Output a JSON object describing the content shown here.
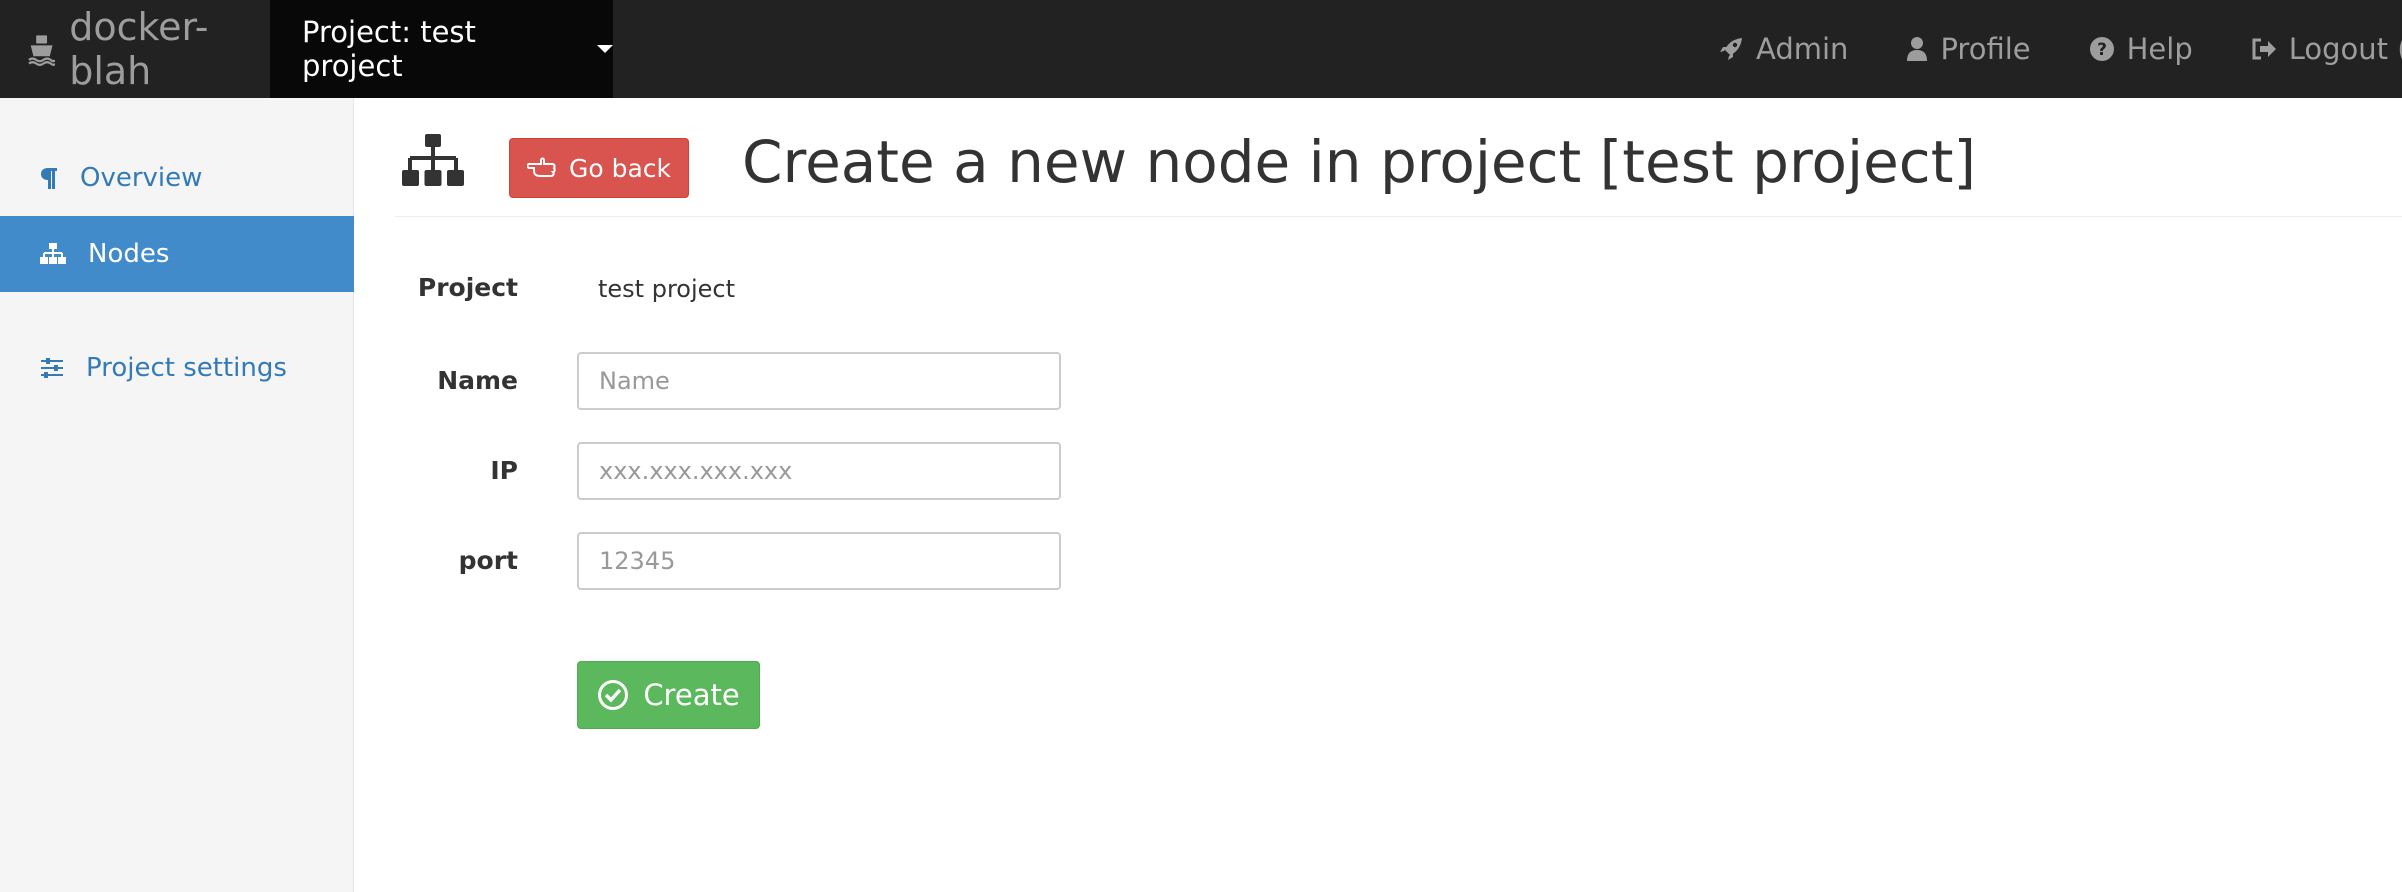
{
  "navbar": {
    "brand": "docker-blah",
    "brand_icon": "ship-icon",
    "project_dropdown": "Project: test project",
    "links": [
      {
        "label": "Admin",
        "icon": "rocket-icon"
      },
      {
        "label": "Profile",
        "icon": "user-icon"
      },
      {
        "label": "Help",
        "icon": "question-circle-icon"
      },
      {
        "label": "Logout (c",
        "icon": "sign-out-icon"
      }
    ]
  },
  "sidebar": {
    "items": [
      {
        "label": "Overview",
        "icon": "paragraph-icon",
        "active": false
      },
      {
        "label": "Nodes",
        "icon": "sitemap-icon",
        "active": true
      },
      {
        "label": "Project settings",
        "icon": "sliders-icon",
        "active": false
      }
    ]
  },
  "main": {
    "header_icon": "sitemap-icon",
    "back_button": "Go back",
    "title": "Create a new node in project [test project]"
  },
  "form": {
    "project_label": "Project",
    "project_value": "test project",
    "name_label": "Name",
    "name_placeholder": "Name",
    "name_value": "",
    "ip_label": "IP",
    "ip_placeholder": "xxx.xxx.xxx.xxx",
    "ip_value": "",
    "port_label": "port",
    "port_placeholder": "12345",
    "port_value": "",
    "submit_label": "Create"
  },
  "colors": {
    "navbar_bg": "#222222",
    "navbar_active_bg": "#080808",
    "sidebar_active": "#428bca",
    "link": "#337ab7",
    "danger": "#d9534f",
    "success": "#5cb85c"
  }
}
